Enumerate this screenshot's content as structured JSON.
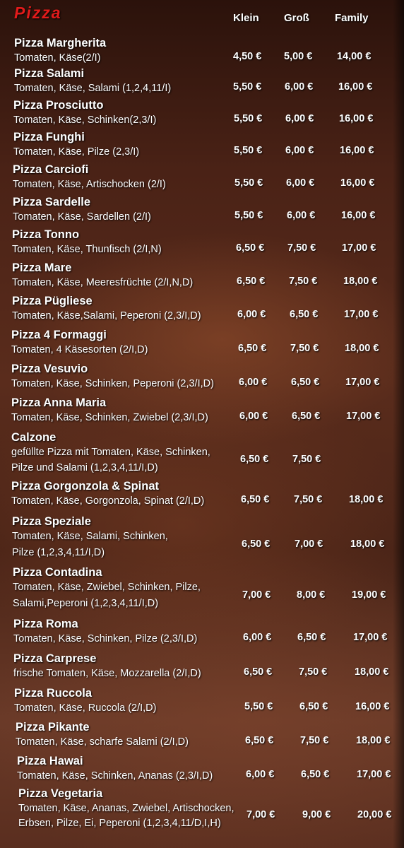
{
  "menu": {
    "title": "Pizza",
    "columns": [
      "Klein",
      "Groß",
      "Family"
    ],
    "items": [
      {
        "name": "Pizza Margherita",
        "desc": [
          "Tomaten, Käse(2/I)"
        ],
        "prices": [
          "4,50 €",
          "5,00 €",
          "14,00 €"
        ]
      },
      {
        "name": "Pizza Salami",
        "desc": [
          "Tomaten, Käse, Salami (1,2,4,11/I)"
        ],
        "prices": [
          "5,50 €",
          "6,00 €",
          "16,00 €"
        ]
      },
      {
        "name": "Pizza Prosciutto",
        "desc": [
          "Tomaten, Käse, Schinken(2,3/I)"
        ],
        "prices": [
          "5,50 €",
          "6,00 €",
          "16,00 €"
        ]
      },
      {
        "name": "Pizza Funghi",
        "desc": [
          "Tomaten, Käse, Pilze (2,3/I)"
        ],
        "prices": [
          "5,50 €",
          "6,00 €",
          "16,00 €"
        ]
      },
      {
        "name": "Pizza Carciofi",
        "desc": [
          "Tomaten, Käse, Artischocken (2/I)"
        ],
        "prices": [
          "5,50 €",
          "6,00 €",
          "16,00 €"
        ]
      },
      {
        "name": "Pizza Sardelle",
        "desc": [
          "Tomaten, Käse, Sardellen (2/I)"
        ],
        "prices": [
          "5,50 €",
          "6,00 €",
          "16,00 €"
        ]
      },
      {
        "name": "Pizza Tonno",
        "desc": [
          "Tomaten, Käse, Thunfisch (2/I,N)"
        ],
        "prices": [
          "6,50 €",
          "7,50 €",
          "17,00 €"
        ]
      },
      {
        "name": "Pizza Mare",
        "desc": [
          "Tomaten, Käse, Meeresfrüchte (2/I,N,D)"
        ],
        "prices": [
          "6,50 €",
          "7,50 €",
          "18,00 €"
        ]
      },
      {
        "name": "Pizza Pügliese",
        "desc": [
          "Tomaten, Käse,Salami, Peperoni (2,3/I,D)"
        ],
        "prices": [
          "6,00 €",
          "6,50 €",
          "17,00 €"
        ]
      },
      {
        "name": "Pizza 4 Formaggi",
        "desc": [
          "Tomaten, 4 Käsesorten (2/I,D)"
        ],
        "prices": [
          "6,50 €",
          "7,50 €",
          "18,00 €"
        ]
      },
      {
        "name": "Pizza Vesuvio",
        "desc": [
          "Tomaten, Käse, Schinken, Peperoni (2,3/I,D)"
        ],
        "prices": [
          "6,00 €",
          "6,50 €",
          "17,00 €"
        ]
      },
      {
        "name": "Pizza Anna Maria",
        "desc": [
          "Tomaten, Käse, Schinken, Zwiebel (2,3/I,D)"
        ],
        "prices": [
          "6,00 €",
          "6,50 €",
          "17,00 €"
        ]
      },
      {
        "name": "Calzone",
        "desc": [
          "gefüllte Pizza mit Tomaten, Käse, Schinken,",
          "Pilze und Salami (1,2,3,4,11/I,D)"
        ],
        "prices": [
          "6,50 €",
          "7,50 €",
          ""
        ]
      },
      {
        "name": "Pizza Gorgonzola & Spinat",
        "desc": [
          "Tomaten, Käse, Gorgonzola, Spinat (2/I,D)"
        ],
        "prices": [
          "6,50 €",
          "7,50 €",
          "18,00 €"
        ]
      },
      {
        "name": "Pizza Speziale",
        "desc": [
          "Tomaten, Käse, Salami, Schinken,",
          "Pilze (1,2,3,4,11/I,D)"
        ],
        "prices": [
          "6,50 €",
          "7,00 €",
          "18,00 €"
        ]
      },
      {
        "name": "Pizza Contadina",
        "desc": [
          "Tomaten, Käse, Zwiebel, Schinken, Pilze,",
          "Salami,Peperoni (1,2,3,4,11/I,D)"
        ],
        "prices": [
          "7,00 €",
          "8,00 €",
          "19,00 €"
        ]
      },
      {
        "name": "Pizza Roma",
        "desc": [
          "Tomaten, Käse, Schinken, Pilze (2,3/I,D)"
        ],
        "prices": [
          "6,00 €",
          "6,50 €",
          "17,00 €"
        ]
      },
      {
        "name": "Pizza Carprese",
        "desc": [
          "frische Tomaten, Käse, Mozzarella (2/I,D)"
        ],
        "prices": [
          "6,50 €",
          "7,50 €",
          "18,00 €"
        ]
      },
      {
        "name": "Pizza Ruccola",
        "desc": [
          "Tomaten, Käse, Ruccola (2/I,D)"
        ],
        "prices": [
          "5,50 €",
          "6,50 €",
          "16,00 €"
        ]
      },
      {
        "name": "Pizza Pikante",
        "desc": [
          "Tomaten, Käse, scharfe Salami (2/I,D)"
        ],
        "prices": [
          "6,50 €",
          "7,50 €",
          "18,00 €"
        ]
      },
      {
        "name": "Pizza Hawai",
        "desc": [
          "Tomaten, Käse, Schinken, Ananas (2,3/I,D)"
        ],
        "prices": [
          "6,00 €",
          "6,50 €",
          "17,00 €"
        ]
      },
      {
        "name": "Pizza Vegetaria",
        "desc": [
          "Tomaten, Käse, Ananas, Zwiebel, Artischocken,",
          "Erbsen, Pilze, Ei, Peperoni (1,2,3,4,11/D,I,H)"
        ],
        "prices": [
          "7,00 €",
          "9,00 €",
          "20,00 €"
        ]
      }
    ]
  }
}
